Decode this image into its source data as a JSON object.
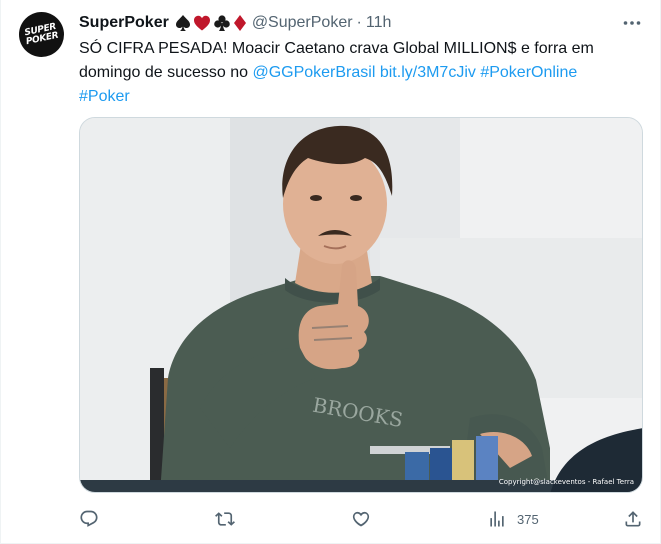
{
  "tweet": {
    "display_name": "SuperPoker",
    "handle": "@SuperPoker",
    "separator": "·",
    "time": "11h",
    "avatar_text_line1": "SUPER",
    "avatar_text_line2": "POKER",
    "suits": [
      "spade",
      "heart",
      "club",
      "diamond"
    ],
    "text_line1": "SÓ CIFRA PESADA! Moacir Caetano crava Global MILLION$ e forra em",
    "text_line2_prefix": "domingo de sucesso no ",
    "mention": "@GGPokerBrasil",
    "link": "bit.ly/3M7cJiv",
    "hashtag1": "#PokerOnline",
    "hashtag2": "#Poker",
    "media_credit": "Copyright@slackeventos - Rafael Terra",
    "media_print_text": "BROOKS"
  },
  "actions": {
    "reply_icon": "reply-icon",
    "retweet_icon": "retweet-icon",
    "like_icon": "heart-icon",
    "views_icon": "views-icon",
    "views_count": "375",
    "share_icon": "share-icon"
  },
  "colors": {
    "link": "#1d9bf0",
    "secondary_text": "#536471",
    "heart_suit": "#c0172b",
    "diamond_suit": "#c0172b"
  }
}
